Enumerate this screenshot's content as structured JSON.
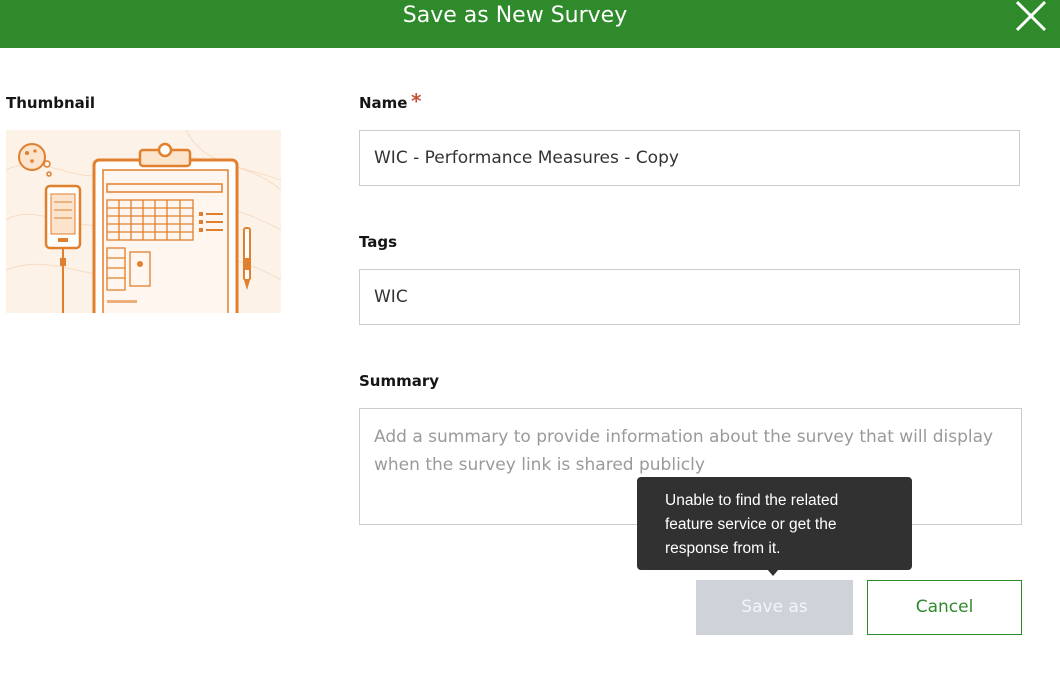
{
  "dialog": {
    "title": "Save as New Survey",
    "close_icon": "close-icon",
    "header_color": "#2f8a2b"
  },
  "thumbnail": {
    "label": "Thumbnail",
    "image_icon": "survey-clipboard-illustration"
  },
  "form": {
    "name": {
      "label": "Name",
      "required_marker": "*",
      "value": "WIC - Performance Measures - Copy"
    },
    "tags": {
      "label": "Tags",
      "value": "WIC"
    },
    "summary": {
      "label": "Summary",
      "value": "",
      "placeholder": "Add a summary to provide information about the survey that will display when the survey link is shared publicly"
    }
  },
  "tooltip": {
    "text": "Unable to find the related feature service or get the response from it."
  },
  "buttons": {
    "save_as": "Save as",
    "cancel": "Cancel"
  }
}
